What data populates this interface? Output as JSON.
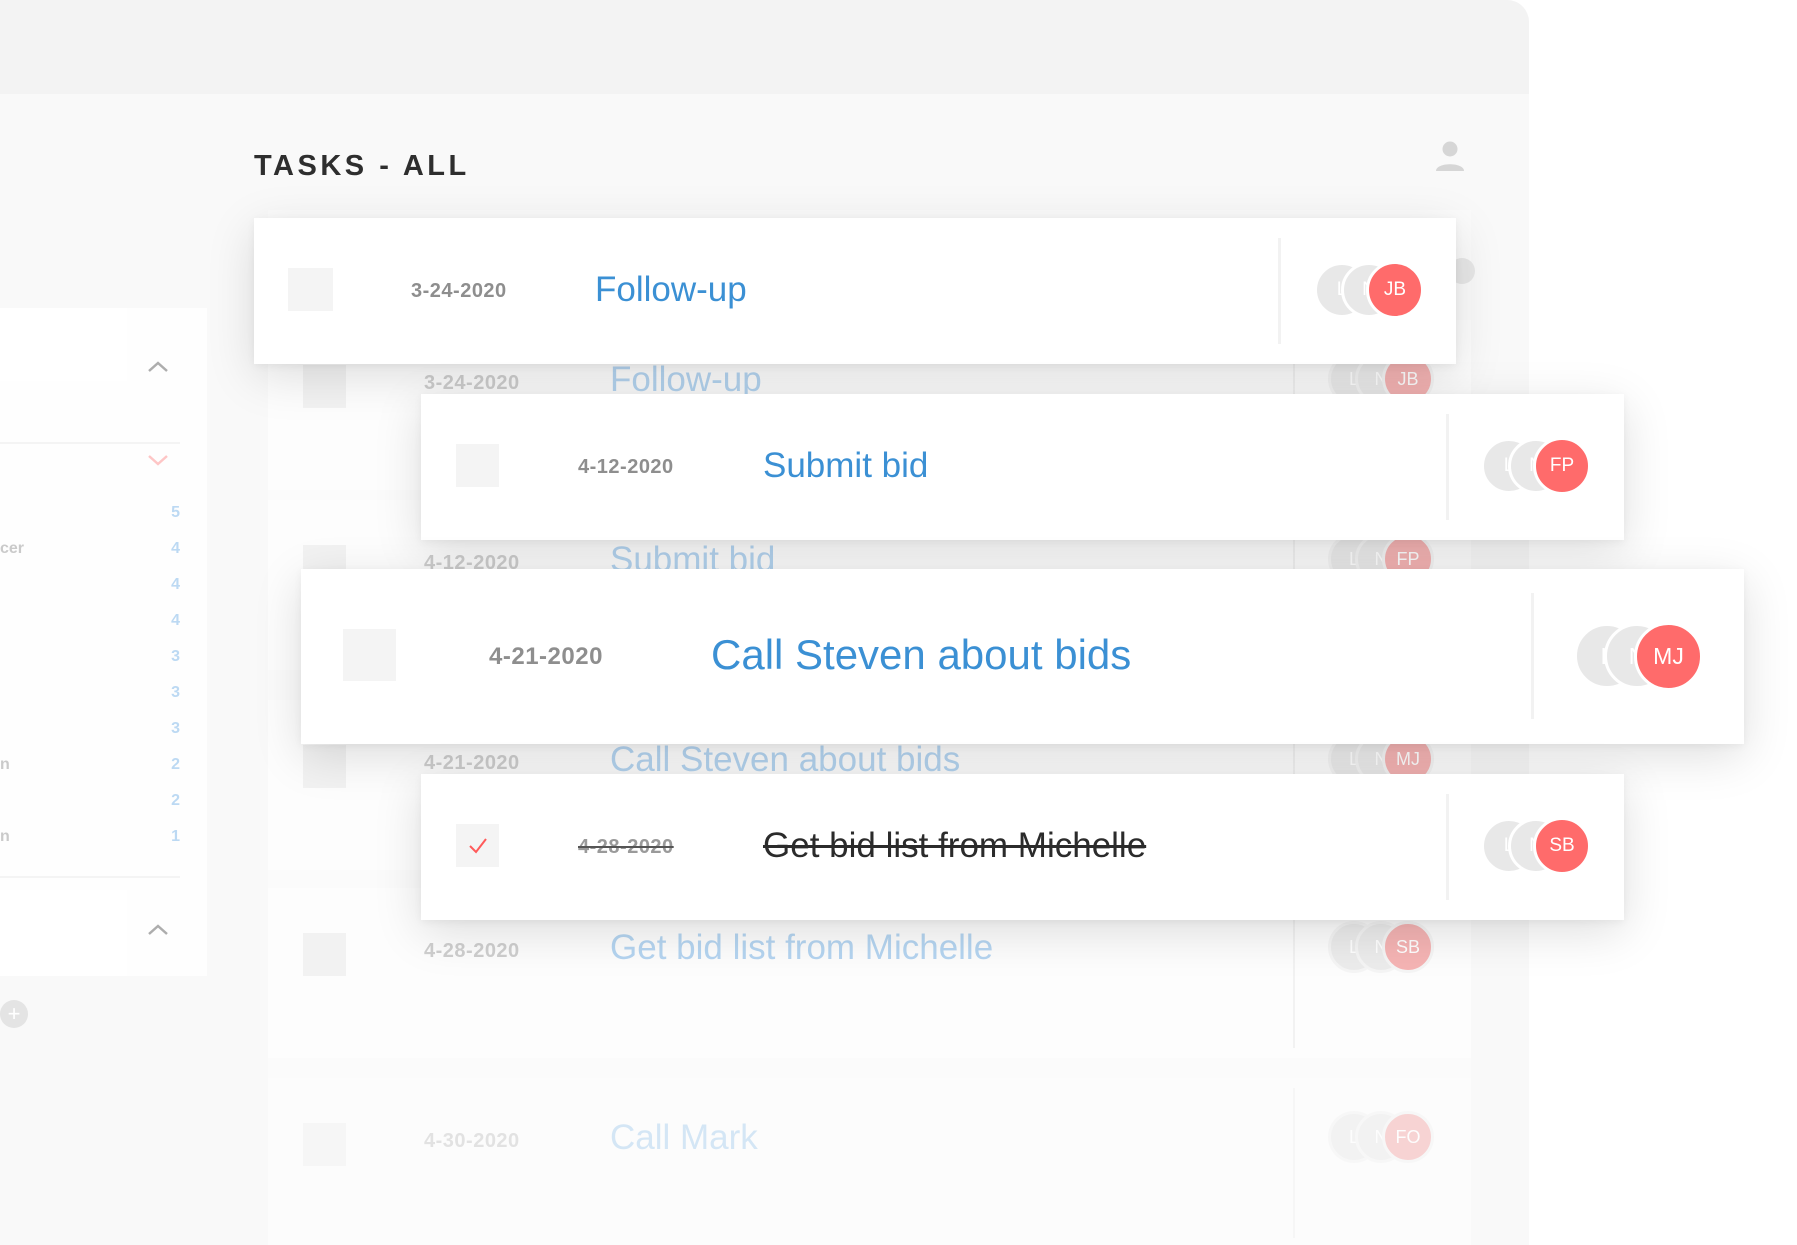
{
  "header": {
    "title": "TASKS - ALL",
    "user_icon": "person-icon"
  },
  "colors": {
    "accent_blue": "#3b90d4",
    "avatar_red": "#ff6b6b",
    "title_dark": "#2e2e2e",
    "date_grey": "#8e8e8e",
    "check_red": "#ff5a5a"
  },
  "sidebar": {
    "section1_chevron": "chevron-up-icon",
    "section2_chevron": "chevron-down-icon",
    "section3_chevron": "chevron-up-icon",
    "add_icon": "plus-icon",
    "items": [
      {
        "label": "",
        "count": "5"
      },
      {
        "label": "cer",
        "count": "4"
      },
      {
        "label": "",
        "count": "4"
      },
      {
        "label": "",
        "count": "4"
      },
      {
        "label": "",
        "count": "3"
      },
      {
        "label": "",
        "count": "3"
      },
      {
        "label": "",
        "count": "3"
      },
      {
        "label": "n",
        "count": "2"
      },
      {
        "label": "",
        "count": "2"
      },
      {
        "label": "n",
        "count": "1"
      }
    ]
  },
  "cards": [
    {
      "date": "3-24-2020",
      "title": "Follow-up",
      "done": false,
      "avatars": [
        "L",
        "N",
        "JB"
      ]
    },
    {
      "date": "4-12-2020",
      "title": "Submit bid",
      "done": false,
      "avatars": [
        "L",
        "N",
        "FP"
      ]
    },
    {
      "date": "4-21-2020",
      "title": "Call Steven about bids",
      "done": false,
      "avatars": [
        "L",
        "N",
        "MJ"
      ]
    },
    {
      "date": "4-28-2020",
      "title": "Get bid list from Michelle",
      "done": true,
      "check_icon": "checkmark-icon",
      "avatars": [
        "L",
        "N",
        "SB"
      ]
    }
  ],
  "background_rows": [
    {
      "date": "3-24-2020",
      "title": "Follow-up",
      "avatars": [
        "L",
        "N",
        "JB"
      ]
    },
    {
      "date": "4-12-2020",
      "title": "Submit bid",
      "avatars": [
        "L",
        "N",
        "FP"
      ]
    },
    {
      "date": "4-21-2020",
      "title": "Call Steven about bids",
      "avatars": [
        "L",
        "N",
        "MJ"
      ]
    },
    {
      "date": "4-28-2020",
      "title": "Get bid list from Michelle",
      "avatars": [
        "L",
        "N",
        "SB"
      ]
    },
    {
      "date": "4-30-2020",
      "title": "Call Mark",
      "avatars": [
        "L",
        "N",
        "FO"
      ]
    }
  ]
}
